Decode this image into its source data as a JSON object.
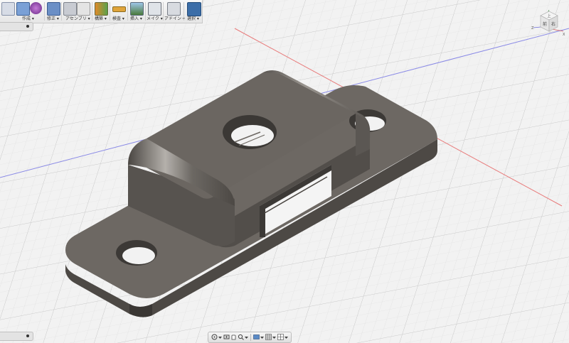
{
  "toolbar": {
    "groups": [
      {
        "label": "作成",
        "icon": "create-icon"
      },
      {
        "label": "修正",
        "icon": "modify-icon"
      },
      {
        "label": "アセンブリ",
        "icon": "assemble-icon"
      },
      {
        "label": "構築",
        "icon": "construct-icon"
      },
      {
        "label": "検査",
        "icon": "inspect-icon"
      },
      {
        "label": "挿入",
        "icon": "insert-icon"
      },
      {
        "label": "メイク",
        "icon": "make-icon"
      },
      {
        "label": "アドイン",
        "icon": "addins-icon"
      },
      {
        "label": "選択",
        "icon": "select-icon"
      }
    ]
  },
  "viewcube": {
    "top_label": "上",
    "front_label": "前",
    "right_label": "右",
    "x_axis": "X",
    "z_axis": "Z"
  },
  "colors": {
    "grid_bg": "#f2f2f2",
    "grid_line": "#d4d4d4",
    "axis_red": "#e87a7a",
    "axis_blue": "#8a8ae6",
    "model_top": "#6b6660",
    "model_side": "#585450",
    "model_dark": "#3f3c39"
  }
}
